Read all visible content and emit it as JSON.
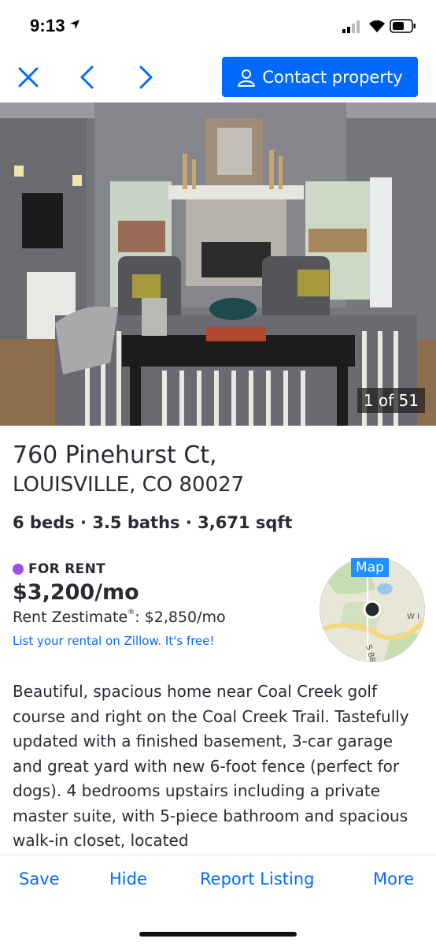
{
  "status_bar": {
    "time": "9:13"
  },
  "nav": {
    "close_icon": "close-icon",
    "prev_icon": "chevron-left-icon",
    "next_icon": "chevron-right-icon",
    "contact_label": "Contact property",
    "contact_icon": "person-icon"
  },
  "photo": {
    "counter": "1 of 51"
  },
  "listing": {
    "address_line1": "760 Pinehurst Ct,",
    "address_line2": "LOUISVILLE, CO 80027",
    "facts": "6 beds · 3.5 baths · 3,671 sqft",
    "status": "FOR RENT",
    "status_color": "#9c4fe0",
    "price": "$3,200/mo",
    "zestimate_label": "Rent Zestimate",
    "zestimate_mark": "®",
    "zestimate_value": ": $2,850/mo",
    "list_link": "List your rental on Zillow. It's free!",
    "map_label": "Map",
    "map_road_label1": "W I",
    "map_road_label2": "S 88",
    "description": "Beautiful, spacious home near Coal Creek golf course and right on the Coal Creek Trail. Tastefully updated with a finished basement, 3-car garage and great yard with new 6-foot fence (perfect for dogs). 4 bedrooms upstairs including a private master suite, with 5-piece bathroom and spacious walk-in closet, located"
  },
  "toolbar": {
    "save": "Save",
    "hide": "Hide",
    "report": "Report Listing",
    "more": "More"
  },
  "colors": {
    "accent": "#006aff",
    "text": "#2a2a33"
  }
}
